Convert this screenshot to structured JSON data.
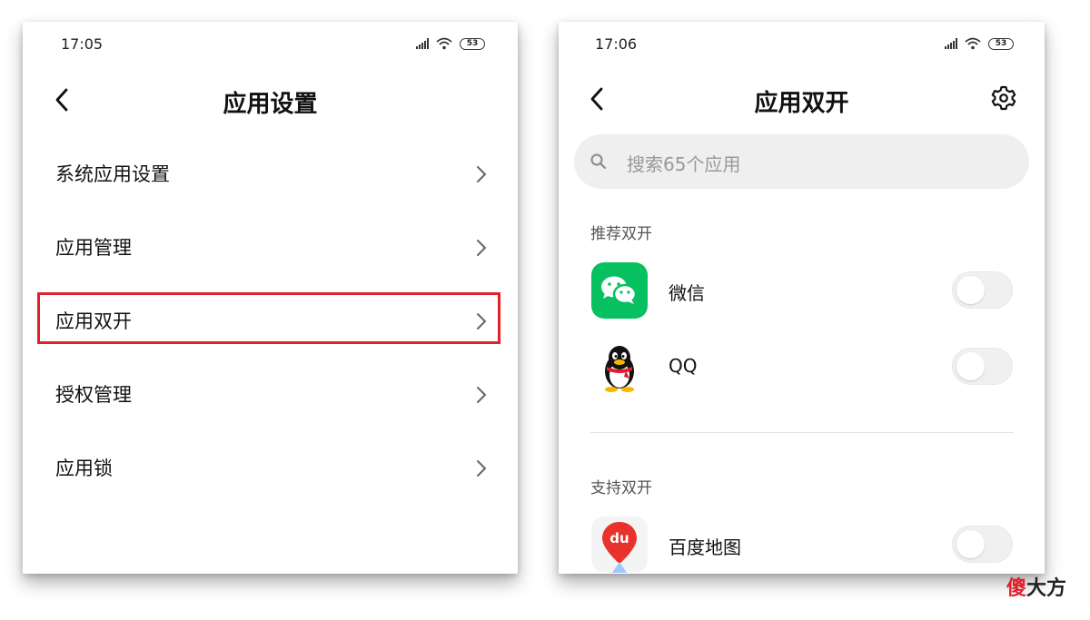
{
  "left_screen": {
    "status_time": "17:05",
    "battery": "53",
    "title": "应用设置",
    "items": [
      {
        "label": "系统应用设置"
      },
      {
        "label": "应用管理"
      },
      {
        "label": "应用双开"
      },
      {
        "label": "授权管理"
      },
      {
        "label": "应用锁"
      }
    ],
    "highlighted_item": "应用双开",
    "highlight_color": "#e0212a"
  },
  "right_screen": {
    "status_time": "17:06",
    "battery": "53",
    "title": "应用双开",
    "search_placeholder": "搜索65个应用",
    "recommended_title": "推荐双开",
    "recommended_apps": [
      {
        "name": "微信",
        "icon": "wechat-icon",
        "enabled": false
      },
      {
        "name": "QQ",
        "icon": "qq-penguin-icon",
        "enabled": false
      }
    ],
    "supported_title": "支持双开",
    "supported_apps": [
      {
        "name": "百度地图",
        "icon": "baidu-map-icon",
        "enabled": false
      }
    ]
  },
  "watermark": {
    "first": "傻",
    "rest": "大方"
  },
  "colors": {
    "wechat_green": "#07c160",
    "baidu_red": "#e8322b",
    "toggle_off": "#f0f0f0"
  }
}
